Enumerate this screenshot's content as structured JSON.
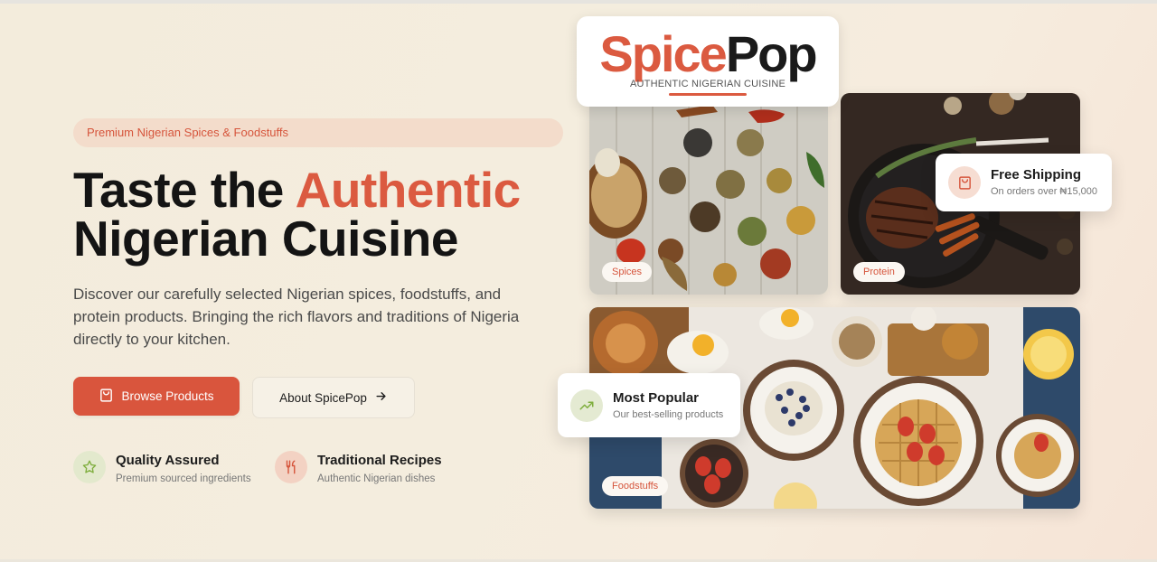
{
  "hero": {
    "badge": "Premium Nigerian Spices & Foodstuffs",
    "title_part1": "Taste the ",
    "title_accent": "Authentic",
    "title_part2": "Nigerian Cuisine",
    "description": "Discover our carefully selected Nigerian spices, foodstuffs, and protein products. Bringing the rich flavors and traditions of Nigeria directly to your kitchen.",
    "primary_button": "Browse Products",
    "secondary_button": "About SpicePop"
  },
  "features": [
    {
      "title": "Quality Assured",
      "subtitle": "Premium sourced ingredients",
      "icon": "star-icon"
    },
    {
      "title": "Traditional Recipes",
      "subtitle": "Authentic Nigerian dishes",
      "icon": "utensils-icon"
    }
  ],
  "logo": {
    "word_part1": "Spice",
    "word_part2": "Pop",
    "tagline": "AUTHENTIC NIGERIAN CUISINE"
  },
  "gallery": {
    "spices_tag": "Spices",
    "protein_tag": "Protein",
    "foodstuffs_tag": "Foodstuffs"
  },
  "cards": {
    "shipping_title": "Free Shipping",
    "shipping_sub": "On orders over ₦15,000",
    "popular_title": "Most Popular",
    "popular_sub": "Our best-selling products"
  },
  "colors": {
    "accent": "#db5a40",
    "background": "#f3ecdc",
    "feature_green": "#e3e9cd",
    "feature_peach": "#f3d2c3"
  }
}
